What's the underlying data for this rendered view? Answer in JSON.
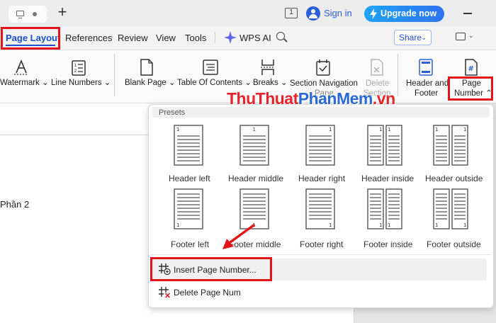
{
  "titlebar": {
    "page_badge": "1",
    "signin_label": "Sign in",
    "upgrade_label": "Upgrade now"
  },
  "menubar": {
    "items": [
      "Page Layout",
      "References",
      "Review",
      "View",
      "Tools"
    ],
    "active": "Page Layout",
    "ai_label": "WPS AI",
    "share_label": "Share"
  },
  "ribbon": {
    "watermark": "Watermark",
    "line_numbers": "Line Numbers",
    "blank_page": "Blank Page",
    "toc": "Table Of Contents",
    "breaks": "Breaks",
    "section_navigation": "Section Navigation",
    "section_navigation_2": "Pane",
    "delete_section": "Delete",
    "delete_section_2": "Section",
    "header_footer": "Header and",
    "header_footer_2": "Footer",
    "page_number": "Page",
    "page_number_2": "Number"
  },
  "document": {
    "text": "Phần 2"
  },
  "watermark_overlay": {
    "part1": "ThuThuat",
    "part2": "PhanMem",
    "part3": ".vn"
  },
  "dropdown": {
    "presets_label": "Presets",
    "header_presets": [
      "Header left",
      "Header middle",
      "Header right",
      "Header inside",
      "Header outside"
    ],
    "footer_presets": [
      "Footer left",
      "Footer middle",
      "Footer right",
      "Footer inside",
      "Footer outside"
    ],
    "insert_page_number": "Insert Page Number...",
    "delete_page_num": "Delete Page Num"
  },
  "colors": {
    "accent": "#1a4fd0",
    "highlight": "#e3131a",
    "upgrade": "#2f73f0"
  },
  "icons": [
    "monitor-icon",
    "plus-icon",
    "avatar-icon",
    "bolt-icon",
    "wps-ai-icon",
    "search-icon",
    "comment-icon",
    "watermark-icon",
    "line-numbers-icon",
    "blank-page-icon",
    "toc-icon",
    "breaks-icon",
    "section-navigation-icon",
    "delete-section-icon",
    "header-footer-icon",
    "page-number-icon",
    "insert-page-number-icon",
    "delete-page-num-icon"
  ]
}
